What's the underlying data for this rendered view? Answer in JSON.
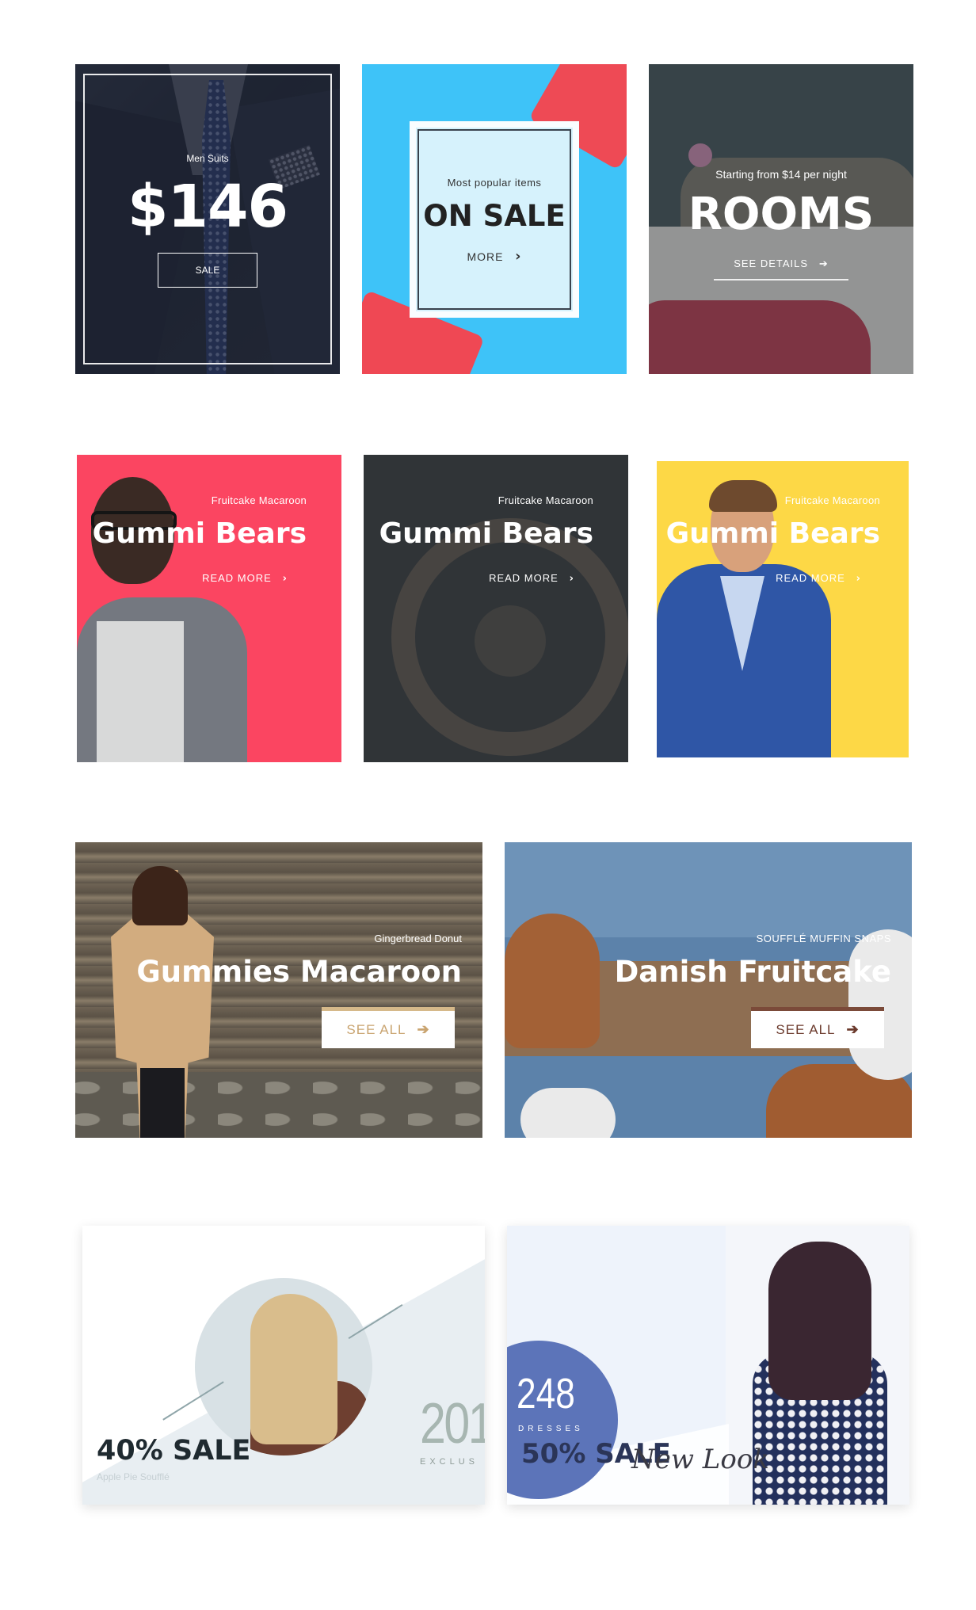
{
  "cards": {
    "suits": {
      "subtitle": "Men Suits",
      "price": "$146",
      "button": "SALE"
    },
    "onsale": {
      "subtitle": "Most popular items",
      "title": "ON SALE",
      "link": "MORE",
      "link_arrow": "›"
    },
    "rooms": {
      "subtitle": "Starting from $14 per night",
      "title": "ROOMS",
      "link": "SEE DETAILS",
      "link_arrow": "➔"
    },
    "gummi_pink": {
      "subtitle": "Fruitcake Macaroon",
      "title": "Gummi Bears",
      "link": "READ MORE",
      "link_arrow": "›"
    },
    "gummi_dark": {
      "subtitle": "Fruitcake Macaroon",
      "title": "Gummi Bears",
      "link": "READ MORE",
      "link_arrow": "›"
    },
    "gummi_yellow": {
      "subtitle": "Fruitcake Macaroon",
      "title": "Gummi Bears",
      "link": "READ MORE",
      "link_arrow": "›"
    },
    "macaroon": {
      "subtitle": "Gingerbread Donut",
      "title": "Gummies Macaroon",
      "button": "SEE ALL",
      "button_arrow": "➔"
    },
    "fruitcake": {
      "subtitle": "SOUFFLÉ MUFFIN SNAPS",
      "title": "Danish Fruitcake",
      "button": "SEE ALL",
      "button_arrow": "➔"
    },
    "sale40": {
      "title": "40% SALE",
      "subtitle": "Apple Pie Soufflé",
      "big_number": "201",
      "tagline": "EXCLUS"
    },
    "dresses": {
      "number": "248",
      "number_label": "DRESSES",
      "title": "50% SALE",
      "script": "New Look"
    }
  },
  "colors": {
    "pink": "#fb4561",
    "yellow": "#fdd846",
    "sky": "#3ec3f8",
    "gold_text": "#c9a470",
    "brown_text": "#6b3a2c",
    "navy": "#5c74b9"
  }
}
